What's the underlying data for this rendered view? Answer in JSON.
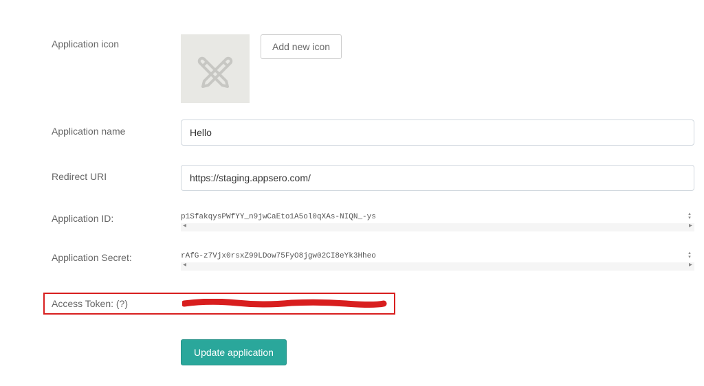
{
  "labels": {
    "icon": "Application icon",
    "name": "Application name",
    "redirect": "Redirect URI",
    "appid": "Application ID:",
    "secret": "Application Secret:",
    "token": "Access Token: (?)"
  },
  "buttons": {
    "add_icon": "Add new icon",
    "submit": "Update application"
  },
  "values": {
    "name": "Hello",
    "redirect": "https://staging.appsero.com/",
    "appid": "p1SfakqysPWfYY_n9jwCaEto1A5ol0qXAs-NIQN_-ys",
    "secret": "rAfG-z7Vjx0rsxZ99LDow75FyO8jgw02CI8eYk3Hheo"
  }
}
